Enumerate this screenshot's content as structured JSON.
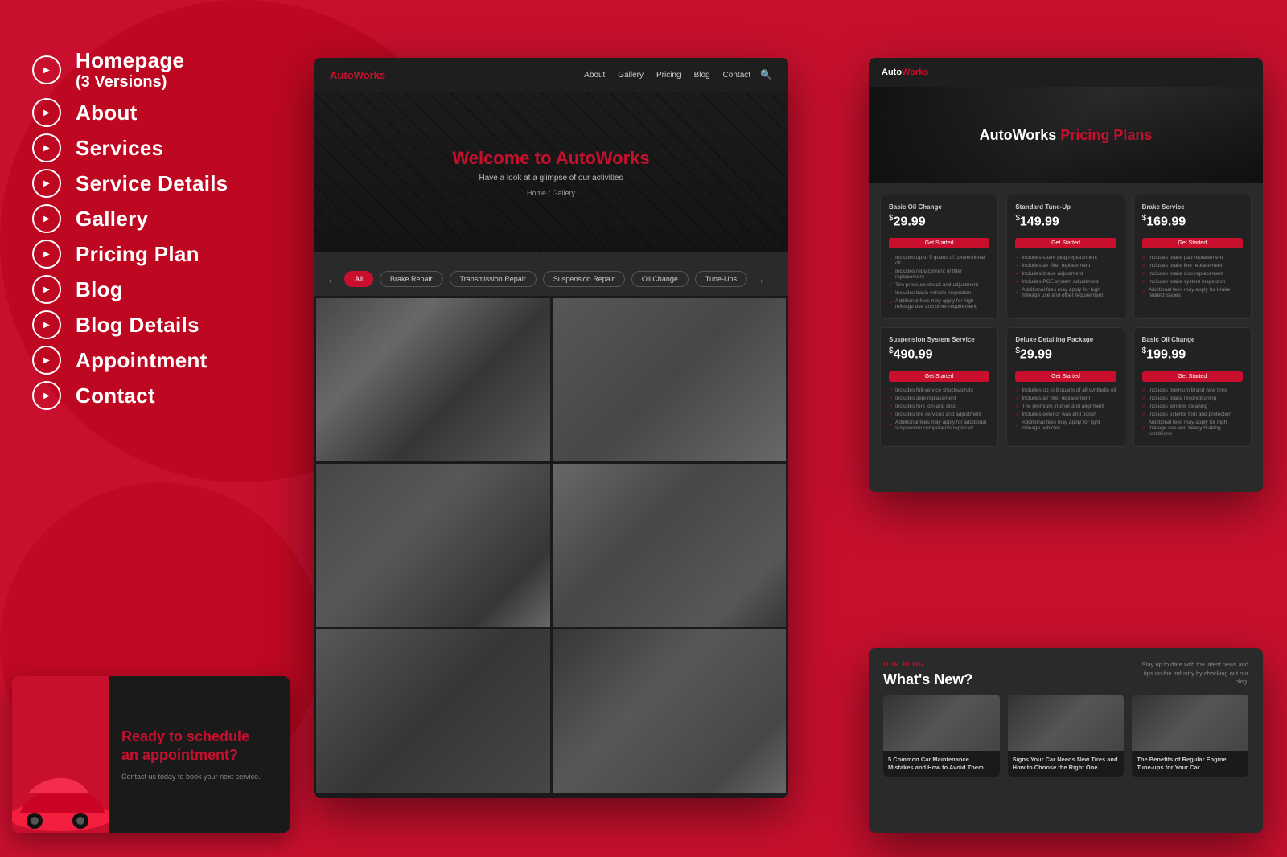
{
  "background": {
    "color": "#c8102e"
  },
  "sidebar": {
    "items": [
      {
        "id": "homepage",
        "label": "Homepage",
        "sublabel": "(3 Versions)"
      },
      {
        "id": "about",
        "label": "About"
      },
      {
        "id": "services",
        "label": "Services"
      },
      {
        "id": "service-details",
        "label": "Service Details"
      },
      {
        "id": "gallery",
        "label": "Gallery"
      },
      {
        "id": "pricing-plan",
        "label": "Pricing Plan"
      },
      {
        "id": "blog",
        "label": "Blog"
      },
      {
        "id": "blog-details",
        "label": "Blog Details"
      },
      {
        "id": "appointment",
        "label": "Appointment"
      },
      {
        "id": "contact",
        "label": "Contact"
      }
    ]
  },
  "main_panel": {
    "logo": "Auto",
    "logo_accent": "Works",
    "nav_links": [
      "About",
      "Gallery",
      "Pricing",
      "Blog",
      "Contact"
    ],
    "hero_title": "Welcome to ",
    "hero_title_accent": "AutoWorks",
    "hero_sub": "Have a look at a glimpse of our activities",
    "hero_breadcrumb": "Home / Gallery",
    "filters": [
      "All",
      "Brake Repair",
      "Transmission Repair",
      "Suspension Repair",
      "Oil Change",
      "Tune-Ups"
    ]
  },
  "pricing_panel": {
    "logo": "Auto",
    "logo_accent": "Works",
    "hero_title": "AutoWorks ",
    "hero_title_accent": "Pricing Plans",
    "cards_row1": [
      {
        "title": "Basic Oil Change",
        "price": "29.99",
        "btn_label": "Get Started",
        "features": [
          "Includes up to 5 quarts of conventional oil",
          "Includes replacement of filter replacement",
          "Tire pressure check and adjustment",
          "Includes basic vehicle inspection",
          "Additional fees may apply for high-mileage use and other requirement"
        ]
      },
      {
        "title": "Standard Tune-Up",
        "price": "149.99",
        "btn_label": "Get Started",
        "features": [
          "Includes spark plug replacement",
          "Includes air filter replacement",
          "Includes brake adjustment",
          "Includes PCE system adjustment",
          "Additional fees may apply for high mileage use and other requirement"
        ]
      },
      {
        "title": "Brake Service",
        "price": "169.99",
        "btn_label": "Get Started",
        "features": [
          "Includes brake pad replacement",
          "Includes brake line replacement",
          "Includes brake disc replacement",
          "Includes brake system inspection",
          "Additional fees may apply for brake-related issues"
        ]
      }
    ],
    "cards_row2": [
      {
        "title": "Suspension System Service",
        "price": "490.99",
        "btn_label": "Get Started",
        "features": [
          "Includes full-service shocks/struts",
          "Includes axle replacement",
          "Includes fork join and disc",
          "Includes tire services and adjustment",
          "Additional fees may apply for additional suspension components replaced"
        ]
      },
      {
        "title": "Deluxe Detailing Package",
        "price": "29.99",
        "btn_label": "Get Started",
        "features": [
          "Includes up to 8 quarts of all synthetic oil",
          "Includes air filter replacement",
          "The premium interior and alignment",
          "Includes exterior wax and polish",
          "Additional fees may apply for light mileage vehicles"
        ]
      },
      {
        "title": "Basic Oil Change",
        "price": "199.99",
        "btn_label": "Get Started",
        "features": [
          "Includes premium brand new tires",
          "Includes brake reconditioning",
          "Includes window cleaning",
          "Includes exterior trim and protection",
          "Additional fees may apply for high mileage use and heavy braking conditions"
        ]
      }
    ]
  },
  "bottom_left": {
    "title_line1": "Ready to schedule",
    "title_line2": "an ",
    "title_accent": "appointment?",
    "sub": "Contact us today to book your next service."
  },
  "blog_panel": {
    "eyebrow": "OUR BLOG",
    "title": "What's New?",
    "sub": "Stay up to date with the latest news and tips on the industry by checking out our blog.",
    "cards": [
      {
        "text": "5 Common Car Maintenance Mistakes and How to Avoid Them"
      },
      {
        "text": "Signs Your Car Needs New Tires and How to Choose the Right One"
      },
      {
        "text": "The Benefits of Regular Engine Tune-ups for Your Car"
      }
    ]
  }
}
